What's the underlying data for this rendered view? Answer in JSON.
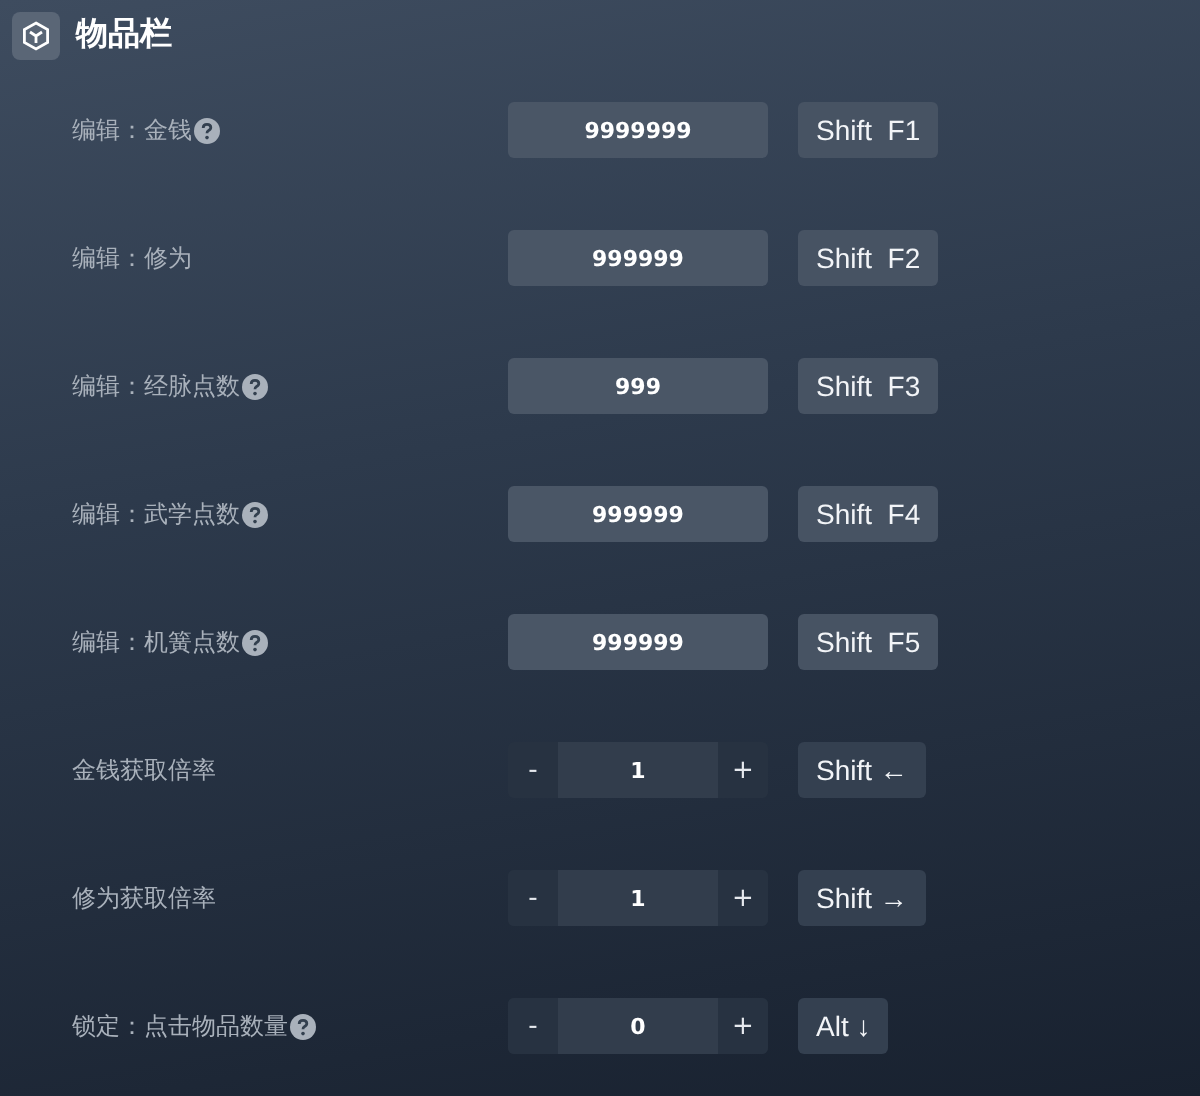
{
  "panel": {
    "title": "物品栏"
  },
  "rows": [
    {
      "kind": "input",
      "label": "编辑：金钱",
      "help": true,
      "value": "9999999",
      "hotkey": "Shift  F1"
    },
    {
      "kind": "input",
      "label": "编辑：修为",
      "help": false,
      "value": "999999",
      "hotkey": "Shift  F2"
    },
    {
      "kind": "input",
      "label": "编辑：经脉点数",
      "help": true,
      "value": "999",
      "hotkey": "Shift  F3"
    },
    {
      "kind": "input",
      "label": "编辑：武学点数",
      "help": true,
      "value": "999999",
      "hotkey": "Shift  F4"
    },
    {
      "kind": "input",
      "label": "编辑：机簧点数",
      "help": true,
      "value": "999999",
      "hotkey": "Shift  F5"
    },
    {
      "kind": "stepper",
      "label": "金钱获取倍率",
      "help": false,
      "minus": "-",
      "value": "1",
      "plus": "+",
      "hotkey": "Shift ←"
    },
    {
      "kind": "stepper",
      "label": "修为获取倍率",
      "help": false,
      "minus": "-",
      "value": "1",
      "plus": "+",
      "hotkey": "Shift →"
    },
    {
      "kind": "stepper",
      "label": "锁定：点击物品数量",
      "help": true,
      "minus": "-",
      "value": "0",
      "plus": "+",
      "hotkey": "Alt ↓"
    }
  ]
}
